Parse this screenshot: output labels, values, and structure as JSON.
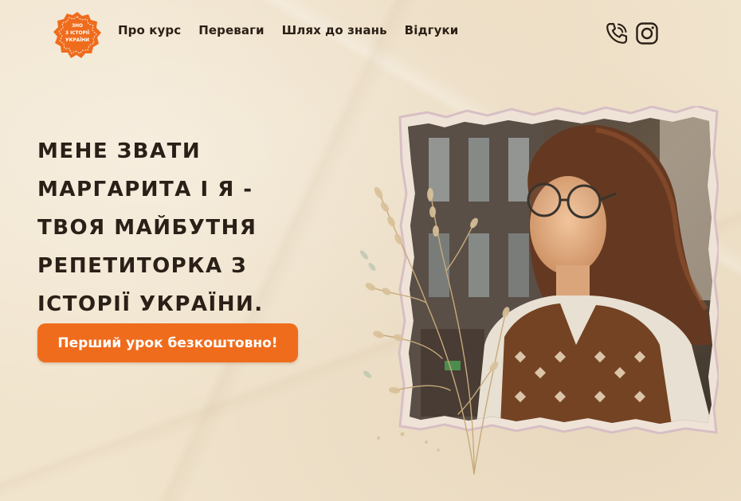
{
  "logo": {
    "lines": [
      "ЗНО",
      "З ІСТОРІЇ",
      "УКРАЇНИ"
    ],
    "color": "#ef6c1d"
  },
  "nav": {
    "items": [
      {
        "label": "Про курс"
      },
      {
        "label": "Переваги"
      },
      {
        "label": "Шлях до знань"
      },
      {
        "label": "Відгуки"
      }
    ]
  },
  "contacts": {
    "phone_icon": "phone-icon",
    "instagram_icon": "instagram-icon"
  },
  "hero": {
    "title": "Мене звати Маргарита і я - твоя майбутня репетиторка з історії України.",
    "cta_label": "Перший урок безкоштовно!",
    "accent_color": "#ef6c1d",
    "photo": "portrait-photo"
  }
}
